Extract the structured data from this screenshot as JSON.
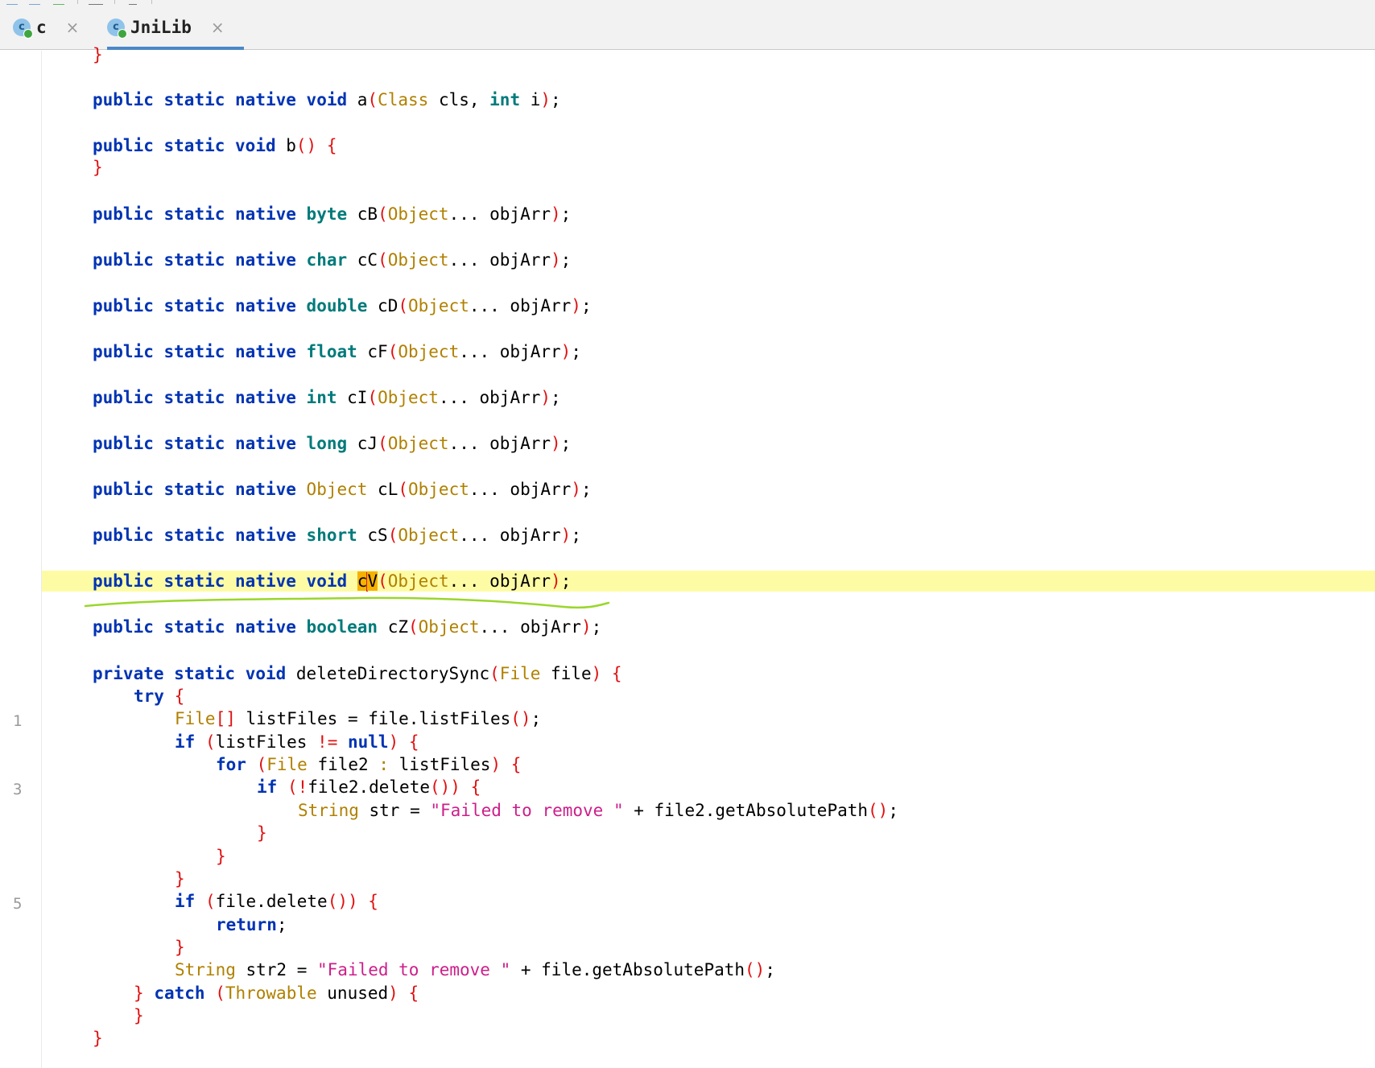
{
  "tabs": [
    {
      "label": "c",
      "icon": "class-icon",
      "active": false
    },
    {
      "label": "JniLib",
      "icon": "class-icon",
      "active": true
    }
  ],
  "icons": {
    "class_icon_letter": "c",
    "close_glyph": "×"
  },
  "gutter_numbers": [
    "1",
    "3",
    "5"
  ],
  "colors": {
    "keyword": "#0033b3",
    "primitive": "#007a7a",
    "type": "#b08000",
    "bracket": "#e01010",
    "string": "#cc1f8a",
    "current_line": "#fefba5",
    "caret_highlight": "#f7b100",
    "annotation_stroke": "#9bd62c",
    "tab_underline": "#4a88c7"
  },
  "code": {
    "line0": [
      [
        "b",
        "}"
      ]
    ],
    "line1": [
      [
        "k",
        "public"
      ],
      [
        "o",
        " "
      ],
      [
        "k",
        "static"
      ],
      [
        "o",
        " "
      ],
      [
        "k",
        "native"
      ],
      [
        "o",
        " "
      ],
      [
        "k",
        "void"
      ],
      [
        "o",
        " a"
      ],
      [
        "b",
        "("
      ],
      [
        "t",
        "Class"
      ],
      [
        "o",
        " cls, "
      ],
      [
        "p",
        "int"
      ],
      [
        "o",
        " i"
      ],
      [
        "b",
        ")"
      ],
      [
        "o",
        ";"
      ]
    ],
    "line2": [
      [
        "k",
        "public"
      ],
      [
        "o",
        " "
      ],
      [
        "k",
        "static"
      ],
      [
        "o",
        " "
      ],
      [
        "k",
        "void"
      ],
      [
        "o",
        " b"
      ],
      [
        "b",
        "()"
      ],
      [
        "o",
        " "
      ],
      [
        "b",
        "{"
      ]
    ],
    "line3": [
      [
        "b",
        "}"
      ]
    ],
    "line4": [
      [
        "k",
        "public"
      ],
      [
        "o",
        " "
      ],
      [
        "k",
        "static"
      ],
      [
        "o",
        " "
      ],
      [
        "k",
        "native"
      ],
      [
        "o",
        " "
      ],
      [
        "p",
        "byte"
      ],
      [
        "o",
        " cB"
      ],
      [
        "b",
        "("
      ],
      [
        "t",
        "Object"
      ],
      [
        "o",
        "... objArr"
      ],
      [
        "b",
        ")"
      ],
      [
        "o",
        ";"
      ]
    ],
    "line5": [
      [
        "k",
        "public"
      ],
      [
        "o",
        " "
      ],
      [
        "k",
        "static"
      ],
      [
        "o",
        " "
      ],
      [
        "k",
        "native"
      ],
      [
        "o",
        " "
      ],
      [
        "p",
        "char"
      ],
      [
        "o",
        " cC"
      ],
      [
        "b",
        "("
      ],
      [
        "t",
        "Object"
      ],
      [
        "o",
        "... objArr"
      ],
      [
        "b",
        ")"
      ],
      [
        "o",
        ";"
      ]
    ],
    "line6": [
      [
        "k",
        "public"
      ],
      [
        "o",
        " "
      ],
      [
        "k",
        "static"
      ],
      [
        "o",
        " "
      ],
      [
        "k",
        "native"
      ],
      [
        "o",
        " "
      ],
      [
        "p",
        "double"
      ],
      [
        "o",
        " cD"
      ],
      [
        "b",
        "("
      ],
      [
        "t",
        "Object"
      ],
      [
        "o",
        "... objArr"
      ],
      [
        "b",
        ")"
      ],
      [
        "o",
        ";"
      ]
    ],
    "line7": [
      [
        "k",
        "public"
      ],
      [
        "o",
        " "
      ],
      [
        "k",
        "static"
      ],
      [
        "o",
        " "
      ],
      [
        "k",
        "native"
      ],
      [
        "o",
        " "
      ],
      [
        "p",
        "float"
      ],
      [
        "o",
        " cF"
      ],
      [
        "b",
        "("
      ],
      [
        "t",
        "Object"
      ],
      [
        "o",
        "... objArr"
      ],
      [
        "b",
        ")"
      ],
      [
        "o",
        ";"
      ]
    ],
    "line8": [
      [
        "k",
        "public"
      ],
      [
        "o",
        " "
      ],
      [
        "k",
        "static"
      ],
      [
        "o",
        " "
      ],
      [
        "k",
        "native"
      ],
      [
        "o",
        " "
      ],
      [
        "p",
        "int"
      ],
      [
        "o",
        " cI"
      ],
      [
        "b",
        "("
      ],
      [
        "t",
        "Object"
      ],
      [
        "o",
        "... objArr"
      ],
      [
        "b",
        ")"
      ],
      [
        "o",
        ";"
      ]
    ],
    "line9": [
      [
        "k",
        "public"
      ],
      [
        "o",
        " "
      ],
      [
        "k",
        "static"
      ],
      [
        "o",
        " "
      ],
      [
        "k",
        "native"
      ],
      [
        "o",
        " "
      ],
      [
        "p",
        "long"
      ],
      [
        "o",
        " cJ"
      ],
      [
        "b",
        "("
      ],
      [
        "t",
        "Object"
      ],
      [
        "o",
        "... objArr"
      ],
      [
        "b",
        ")"
      ],
      [
        "o",
        ";"
      ]
    ],
    "line10": [
      [
        "k",
        "public"
      ],
      [
        "o",
        " "
      ],
      [
        "k",
        "static"
      ],
      [
        "o",
        " "
      ],
      [
        "k",
        "native"
      ],
      [
        "o",
        " "
      ],
      [
        "t",
        "Object"
      ],
      [
        "o",
        " cL"
      ],
      [
        "b",
        "("
      ],
      [
        "t",
        "Object"
      ],
      [
        "o",
        "... objArr"
      ],
      [
        "b",
        ")"
      ],
      [
        "o",
        ";"
      ]
    ],
    "line11": [
      [
        "k",
        "public"
      ],
      [
        "o",
        " "
      ],
      [
        "k",
        "static"
      ],
      [
        "o",
        " "
      ],
      [
        "k",
        "native"
      ],
      [
        "o",
        " "
      ],
      [
        "p",
        "short"
      ],
      [
        "o",
        " cS"
      ],
      [
        "b",
        "("
      ],
      [
        "t",
        "Object"
      ],
      [
        "o",
        "... objArr"
      ],
      [
        "b",
        ")"
      ],
      [
        "o",
        ";"
      ]
    ],
    "line12": [
      [
        "k",
        "public"
      ],
      [
        "o",
        " "
      ],
      [
        "k",
        "static"
      ],
      [
        "o",
        " "
      ],
      [
        "k",
        "native"
      ],
      [
        "o",
        " "
      ],
      [
        "k",
        "void"
      ],
      [
        "o",
        " "
      ],
      [
        "caret",
        "cV"
      ],
      [
        "b",
        "("
      ],
      [
        "t",
        "Object"
      ],
      [
        "o",
        "... objArr"
      ],
      [
        "b",
        ")"
      ],
      [
        "o",
        ";"
      ]
    ],
    "line13": [
      [
        "k",
        "public"
      ],
      [
        "o",
        " "
      ],
      [
        "k",
        "static"
      ],
      [
        "o",
        " "
      ],
      [
        "k",
        "native"
      ],
      [
        "o",
        " "
      ],
      [
        "p",
        "boolean"
      ],
      [
        "o",
        " cZ"
      ],
      [
        "b",
        "("
      ],
      [
        "t",
        "Object"
      ],
      [
        "o",
        "... objArr"
      ],
      [
        "b",
        ")"
      ],
      [
        "o",
        ";"
      ]
    ],
    "line14": [
      [
        "k",
        "private"
      ],
      [
        "o",
        " "
      ],
      [
        "k",
        "static"
      ],
      [
        "o",
        " "
      ],
      [
        "k",
        "void"
      ],
      [
        "o",
        " deleteDirectorySync"
      ],
      [
        "b",
        "("
      ],
      [
        "t",
        "File"
      ],
      [
        "o",
        " file"
      ],
      [
        "b",
        ")"
      ],
      [
        "o",
        " "
      ],
      [
        "b",
        "{"
      ]
    ],
    "line15": [
      [
        "k",
        "try"
      ],
      [
        "o",
        " "
      ],
      [
        "b",
        "{"
      ]
    ],
    "line16": [
      [
        "t",
        "File"
      ],
      [
        "b",
        "[]"
      ],
      [
        "o",
        " listFiles = file.listFiles"
      ],
      [
        "b",
        "()"
      ],
      [
        "o",
        ";"
      ]
    ],
    "line17": [
      [
        "k",
        "if"
      ],
      [
        "o",
        " "
      ],
      [
        "b",
        "("
      ],
      [
        "o",
        "listFiles "
      ],
      [
        "b",
        "!="
      ],
      [
        "o",
        " "
      ],
      [
        "k",
        "null"
      ],
      [
        "b",
        ")"
      ],
      [
        "o",
        " "
      ],
      [
        "b",
        "{"
      ]
    ],
    "line18": [
      [
        "k",
        "for"
      ],
      [
        "o",
        " "
      ],
      [
        "b",
        "("
      ],
      [
        "t",
        "File"
      ],
      [
        "o",
        " file2 "
      ],
      [
        "t",
        ":"
      ],
      [
        "o",
        " listFiles"
      ],
      [
        "b",
        ")"
      ],
      [
        "o",
        " "
      ],
      [
        "b",
        "{"
      ]
    ],
    "line19": [
      [
        "k",
        "if"
      ],
      [
        "o",
        " "
      ],
      [
        "b",
        "("
      ],
      [
        "b",
        "!"
      ],
      [
        "o",
        "file2.delete"
      ],
      [
        "b",
        "())"
      ],
      [
        "o",
        " "
      ],
      [
        "b",
        "{"
      ]
    ],
    "line20": [
      [
        "t",
        "String"
      ],
      [
        "o",
        " str = "
      ],
      [
        "s",
        "\"Failed to remove \""
      ],
      [
        "o",
        " + file2.getAbsolutePath"
      ],
      [
        "b",
        "()"
      ],
      [
        "o",
        ";"
      ]
    ],
    "line21": [
      [
        "b",
        "}"
      ]
    ],
    "line22": [
      [
        "b",
        "}"
      ]
    ],
    "line23": [
      [
        "b",
        "}"
      ]
    ],
    "line24": [
      [
        "k",
        "if"
      ],
      [
        "o",
        " "
      ],
      [
        "b",
        "("
      ],
      [
        "o",
        "file.delete"
      ],
      [
        "b",
        "())"
      ],
      [
        "o",
        " "
      ],
      [
        "b",
        "{"
      ]
    ],
    "line25": [
      [
        "k",
        "return"
      ],
      [
        "o",
        ";"
      ]
    ],
    "line26": [
      [
        "b",
        "}"
      ]
    ],
    "line27": [
      [
        "t",
        "String"
      ],
      [
        "o",
        " str2 = "
      ],
      [
        "s",
        "\"Failed to remove \""
      ],
      [
        "o",
        " + file.getAbsolutePath"
      ],
      [
        "b",
        "()"
      ],
      [
        "o",
        ";"
      ]
    ],
    "line28": [
      [
        "b",
        "}"
      ],
      [
        "o",
        " "
      ],
      [
        "k",
        "catch"
      ],
      [
        "o",
        " "
      ],
      [
        "b",
        "("
      ],
      [
        "t",
        "Throwable"
      ],
      [
        "o",
        " unused"
      ],
      [
        "b",
        ")"
      ],
      [
        "o",
        " "
      ],
      [
        "b",
        "{"
      ]
    ],
    "line29": [
      [
        "b",
        "}"
      ]
    ],
    "line30": [
      [
        "b",
        "}"
      ]
    ]
  }
}
